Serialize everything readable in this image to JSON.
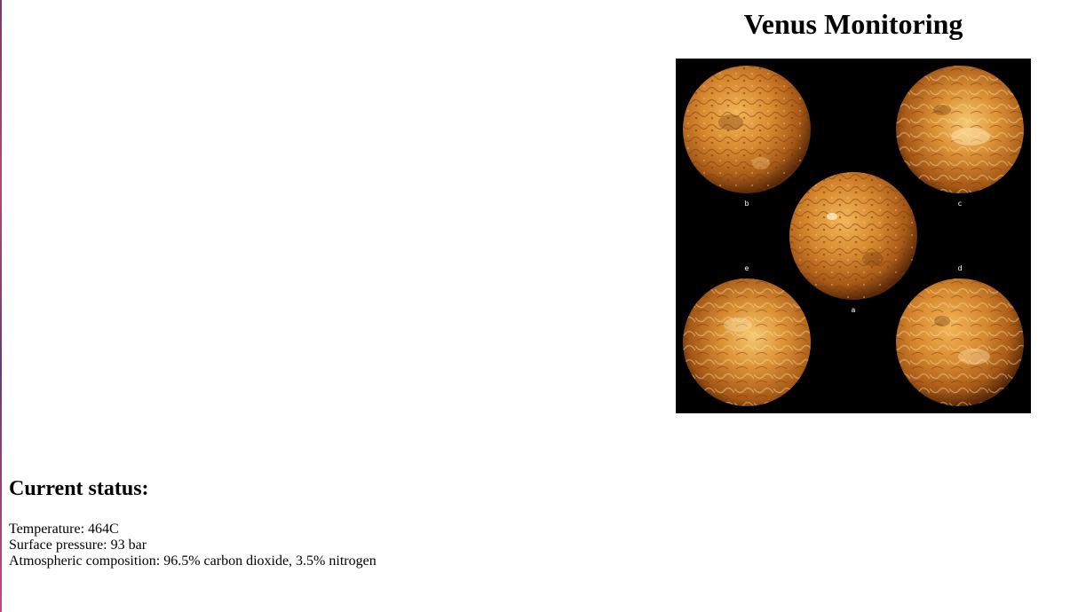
{
  "header": {
    "title": "Venus Monitoring"
  },
  "figure": {
    "panel_labels": [
      "b",
      "c",
      "a",
      "e",
      "d"
    ],
    "colors": {
      "background": "#000000",
      "planet_light": "#f0b050",
      "planet_mid": "#c07020",
      "planet_dark": "#5a2a08"
    }
  },
  "status": {
    "heading": "Current status:",
    "temperature": "Temperature: 464C",
    "pressure": "Surface pressure: 93 bar",
    "composition": "Atmospheric composition: 96.5% carbon dioxide, 3.5% nitrogen"
  }
}
